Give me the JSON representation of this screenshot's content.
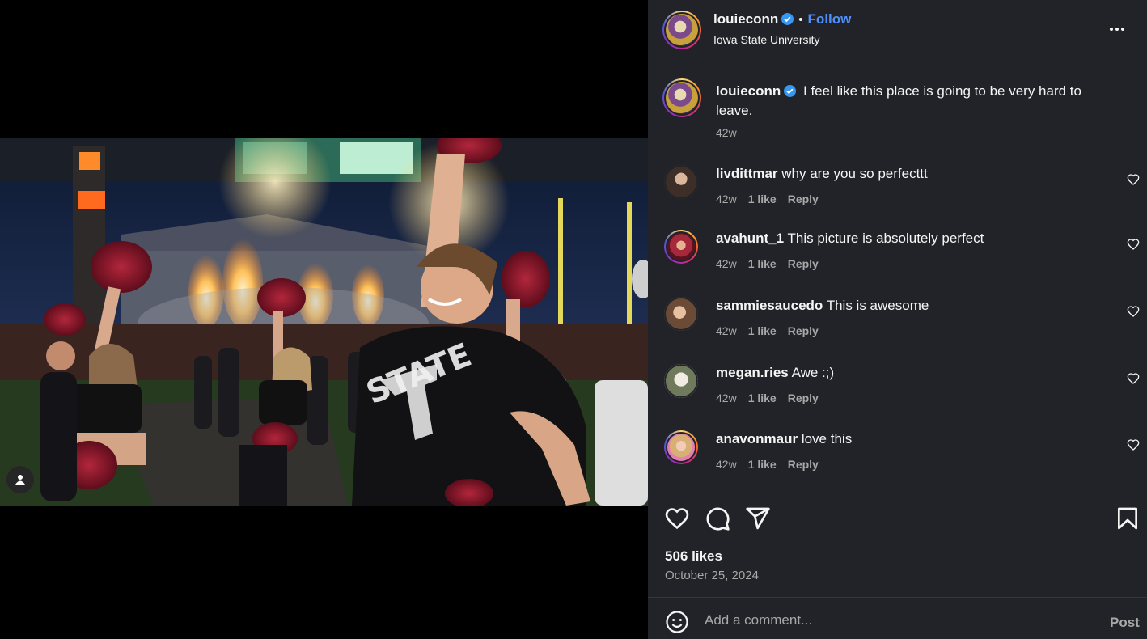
{
  "post": {
    "author": "louieconn",
    "follow_label": "Follow",
    "dot": "•",
    "location": "Iowa State University",
    "more_icon": "more-horizontal-icon",
    "caption": "I feel like this place is going to be very hard to leave.",
    "caption_age": "42w",
    "likes": "506 likes",
    "date": "October 25, 2024"
  },
  "comments": [
    {
      "user": "livdittmar",
      "text": "why are you so perfecttt",
      "age": "42w",
      "likes": "1 like",
      "reply": "Reply",
      "avatar_color": "#5a4a3f"
    },
    {
      "user": "avahunt_1",
      "text": "This picture is absolutely perfect",
      "age": "42w",
      "likes": "1 like",
      "reply": "Reply",
      "avatar_color": "#a5293a"
    },
    {
      "user": "sammiesaucedo",
      "text": "This is awesome",
      "age": "42w",
      "likes": "1 like",
      "reply": "Reply",
      "avatar_color": "#8d6b52"
    },
    {
      "user": "megan.ries",
      "text": "Awe :;)",
      "age": "42w",
      "likes": "1 like",
      "reply": "Reply",
      "avatar_color": "#d8d3c8"
    },
    {
      "user": "anavonmaur",
      "text": "love this",
      "age": "42w",
      "likes": "1 like",
      "reply": "Reply",
      "avatar_color": "#e3b9a3"
    }
  ],
  "add_comment": {
    "placeholder": "Add a comment...",
    "post_label": "Post"
  },
  "colors": {
    "panel_bg": "#212328",
    "link_blue": "#4f8ff7",
    "muted": "#a8a8a8",
    "verified_blue": "#3897f0"
  },
  "icons": [
    "heart-icon",
    "comment-icon",
    "share-icon",
    "bookmark-icon",
    "emoji-icon",
    "user-tag-icon",
    "verified-badge-icon"
  ]
}
